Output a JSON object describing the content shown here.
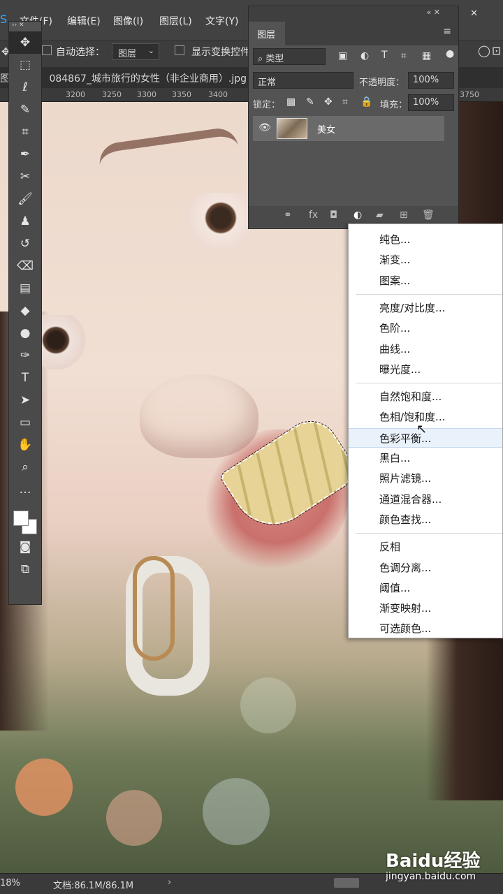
{
  "app": {
    "logo": "S"
  },
  "menubar": {
    "items": [
      {
        "label": "文件(F)"
      },
      {
        "label": "编辑(E)"
      },
      {
        "label": "图像(I)"
      },
      {
        "label": "图层(L)"
      },
      {
        "label": "文字(Y)"
      }
    ]
  },
  "options": {
    "auto_select_label": "自动选择：",
    "auto_select_value": "图层",
    "show_transform_label": "显示变换控件"
  },
  "document": {
    "tab_title": "084867_城市旅行的女性（非企业商用）.jpg"
  },
  "ruler": {
    "ticks": [
      "3200",
      "3250",
      "3300",
      "3350",
      "3400",
      "3750"
    ]
  },
  "layers_panel": {
    "title": "图层",
    "filter_kind": "类型",
    "blend_mode": "正常",
    "opacity_label": "不透明度：",
    "opacity_value": "100%",
    "lock_label": "锁定：",
    "fill_label": "填充：",
    "fill_value": "100%",
    "layers": [
      {
        "name": "美女",
        "visible": true
      }
    ],
    "footer_icons": [
      "link-icon",
      "fx-icon",
      "mask-icon",
      "adjustment-icon",
      "folder-icon",
      "new-layer-icon",
      "trash-icon"
    ]
  },
  "adjustment_menu": {
    "highlighted_index": 9,
    "groups": [
      [
        "纯色...",
        "渐变...",
        "图案..."
      ],
      [
        "亮度/对比度...",
        "色阶...",
        "曲线...",
        "曝光度..."
      ],
      [
        "自然饱和度...",
        "色相/饱和度...",
        "色彩平衡...",
        "黑白...",
        "照片滤镜...",
        "通道混合器...",
        "颜色查找..."
      ],
      [
        "反相",
        "色调分离...",
        "阈值...",
        "渐变映射...",
        "可选颜色..."
      ]
    ]
  },
  "status": {
    "zoom": "18%",
    "doc_size": "文档:86.1M/86.1M"
  },
  "watermark": {
    "brand": "Baidu经验",
    "url": "jingyan.baidu.com"
  },
  "colors": {
    "selection": "#ffffff",
    "accent": "#31a8ff",
    "menu_highlight": "#e9f1fb"
  }
}
